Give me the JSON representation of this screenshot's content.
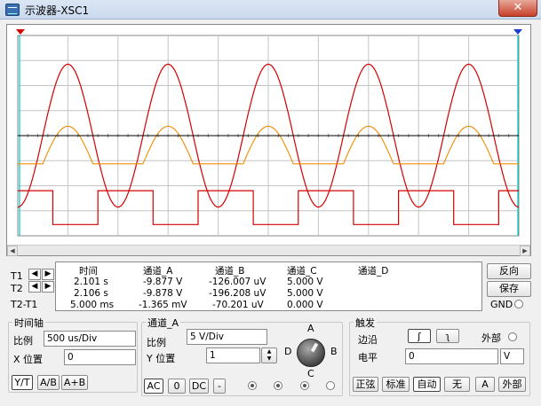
{
  "window": {
    "title": "示波器-XSC1",
    "close_label": "✕"
  },
  "readout": {
    "headers": [
      "时间",
      "通道_A",
      "通道_B",
      "通道_C",
      "通道_D"
    ],
    "rows": [
      {
        "label": "T1",
        "time": "2.101 s",
        "a": "-9.877 V",
        "b": "-126.007 uV",
        "c": "5.000 V",
        "d": ""
      },
      {
        "label": "T2",
        "time": "2.106 s",
        "a": "-9.878 V",
        "b": "-196.208 uV",
        "c": "5.000 V",
        "d": ""
      },
      {
        "label": "T2-T1",
        "time": "5.000 ms",
        "a": "-1.365 mV",
        "b": "-70.201 uV",
        "c": "0.000 V",
        "d": ""
      }
    ]
  },
  "side_buttons": {
    "reverse": "反向",
    "save": "保存",
    "gnd": "GND"
  },
  "timebase": {
    "title": "时间轴",
    "scale_label": "比例",
    "scale_value": "500 us/Div",
    "xpos_label": "X 位置",
    "xpos_value": "0",
    "modes": [
      "Y/T",
      "A/B",
      "A+B"
    ]
  },
  "channel_a": {
    "title": "通道_A",
    "scale_label": "比例",
    "scale_value": "5  V/Div",
    "ypos_label": "Y 位置",
    "ypos_value": "1",
    "coupling": [
      "AC",
      "0",
      "DC",
      "-"
    ],
    "knob_labels": [
      "A",
      "B",
      "C",
      "D"
    ]
  },
  "trigger": {
    "title": "触发",
    "edge_label": "边沿",
    "edge_rise": "ʃ",
    "edge_fall": "ʅ",
    "external_label": "外部",
    "level_label": "电平",
    "level_value": "0",
    "level_unit": "V",
    "modes": [
      "正弦",
      "标准",
      "自动",
      "无"
    ],
    "source_a": "A",
    "source_ext": "外部"
  },
  "colors": {
    "grid": "#c4c4c4",
    "channel_red": "#d40000",
    "channel_orange": "#f08c00",
    "cursor": "#00c8c8",
    "marker_t2": "#1a3fcc"
  },
  "chart_data": {
    "type": "line",
    "series": [
      {
        "color": "#d40000",
        "shape": "sine",
        "period_ms": 10,
        "amplitude_div": 2.85,
        "peaks_visible": 5
      },
      {
        "color": "#f08c00",
        "shape": "half-wave rectified sine",
        "period_ms": 10,
        "amplitude_div": 1.5,
        "peaks_visible": 5
      },
      {
        "color": "#000000",
        "shape": "flat line",
        "value_div": 0
      },
      {
        "color": "#d40000",
        "shape": "square wave",
        "period_ms": 10,
        "high_div": 0,
        "low_div": -1
      }
    ],
    "x_divisions": 10,
    "y_divisions": 8
  }
}
